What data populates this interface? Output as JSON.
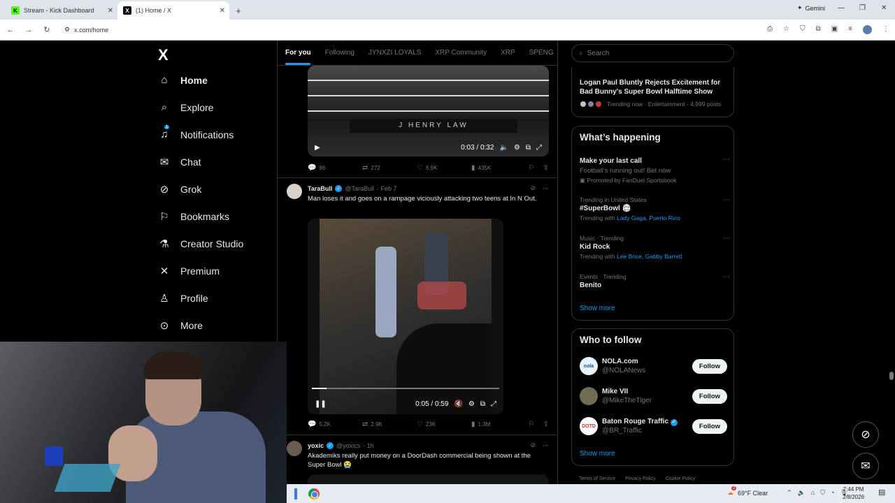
{
  "browser": {
    "tabs": [
      {
        "title": "Stream - Kick Dashboard",
        "icon": "kick-icon",
        "favicon_text": "K"
      },
      {
        "title": "(1) Home / X",
        "icon": "x-icon",
        "favicon_text": "X"
      }
    ],
    "gemini_label": "Gemini",
    "url": "x.com/home"
  },
  "nav": {
    "logo": "X",
    "items": [
      {
        "label": "Home",
        "icon": "home-icon"
      },
      {
        "label": "Explore",
        "icon": "search-icon"
      },
      {
        "label": "Notifications",
        "icon": "bell-icon",
        "badge": "1"
      },
      {
        "label": "Chat",
        "icon": "mail-icon"
      },
      {
        "label": "Grok",
        "icon": "grok-icon"
      },
      {
        "label": "Bookmarks",
        "icon": "bookmark-icon"
      },
      {
        "label": "Creator Studio",
        "icon": "flask-icon"
      },
      {
        "label": "Premium",
        "icon": "x-icon"
      },
      {
        "label": "Profile",
        "icon": "person-icon"
      },
      {
        "label": "More",
        "icon": "more-icon"
      }
    ]
  },
  "timeline": {
    "tabs": [
      "For you",
      "Following",
      "JYNXZI LOYALS",
      "XRP Community",
      "XRP",
      "SPENG"
    ],
    "post1": {
      "video_time": "0:03 / 0:32",
      "banner": "J HENRY LAW",
      "replies": "86",
      "reposts": "272",
      "likes": "6.9K",
      "views": "435K"
    },
    "post2": {
      "name": "TaraBull",
      "handle": "@TaraBull",
      "time": "· Feb 7",
      "text": "Man loses it and goes on a rampage viciously attacking two teens at In N Out.",
      "video_time": "0:05 / 0:59",
      "progress": 0.08,
      "replies": "5.2K",
      "reposts": "2.9K",
      "likes": "23K",
      "views": "1.3M"
    },
    "post3": {
      "name": "yoxic",
      "handle": "@yoxics",
      "time": "· 1h",
      "text": "Akademiks really put money on a DoorDash commercial being shown at the Super Bowl 😭"
    }
  },
  "right": {
    "search_placeholder": "Search",
    "news": {
      "title": "Logan Paul Bluntly Rejects Excitement for Bad Bunny's Super Bowl Halftime Show",
      "meta": "Trending now · Entertainment · 4,999 posts"
    },
    "happening": {
      "heading": "What’s happening",
      "promo": {
        "title": "Make your last call",
        "text": "Football’s running out! Bet now",
        "sub": "Promoted by FanDuel Sportsbook"
      },
      "trends": [
        {
          "ctx": "Trending in United States",
          "title": "#SuperBowl 🏟",
          "with": "Trending with",
          "links": "Lady Gaga, Puerto Rico"
        },
        {
          "ctx": "Music · Trending",
          "title": "Kid Rock",
          "with": "Trending with",
          "links": "Lee Brice, Gabby Barrett"
        },
        {
          "ctx": "Events · Trending",
          "title": "Benito"
        }
      ],
      "show_more": "Show more"
    },
    "follow": {
      "heading": "Who to follow",
      "accounts": [
        {
          "name": "NOLA.com",
          "handle": "@NOLANews",
          "avatar_text": "nola",
          "color": "#e6f2ff"
        },
        {
          "name": "Mike VII",
          "handle": "@MikeTheTiger",
          "avatar_text": "",
          "color": "#6f6b55"
        },
        {
          "name": "Baton Rouge Traffic",
          "handle": "@BR_Traffic",
          "avatar_text": "DOTD",
          "color": "#ffffff"
        }
      ],
      "button": "Follow",
      "show_more": "Show more"
    },
    "footer": [
      "Terms of Service",
      "Privacy Policy",
      "Cookie Policy"
    ]
  },
  "taskbar": {
    "weather_badge": "2",
    "weather": "69°F  Clear",
    "time": "7:44 PM",
    "date": "2/8/2026"
  }
}
